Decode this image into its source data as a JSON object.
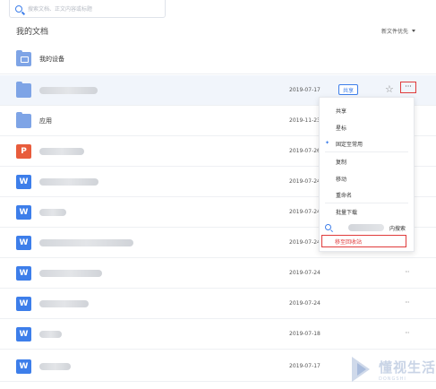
{
  "search": {
    "placeholder": "搜索文档、正文内容或标题"
  },
  "header": {
    "title": "我的文档",
    "sort_label": "新文件优先"
  },
  "rows": [
    {
      "icon": "folder-device-icon",
      "name": "我的设备",
      "date": "",
      "blur": false
    },
    {
      "icon": "folder-icon",
      "name": "",
      "date": "2019-07-17",
      "blur": true
    },
    {
      "icon": "folder-icon",
      "name": "应用",
      "date": "2019-11-23",
      "blur": false
    },
    {
      "icon": "wps-p-icon",
      "name": "",
      "date": "2019-07-26",
      "blur": true
    },
    {
      "icon": "wps-w-icon",
      "name": "",
      "date": "2019-07-24",
      "blur": true
    },
    {
      "icon": "wps-w-icon",
      "name": "",
      "date": "2019-07-24",
      "blur": true
    },
    {
      "icon": "wps-w-icon",
      "name": "",
      "date": "2019-07-24",
      "blur": true
    },
    {
      "icon": "wps-w-icon",
      "name": "",
      "date": "2019-07-24",
      "blur": true
    },
    {
      "icon": "wps-w-icon",
      "name": "",
      "date": "2019-07-24",
      "blur": true
    },
    {
      "icon": "wps-w-icon",
      "name": "",
      "date": "2019-07-18",
      "blur": true
    },
    {
      "icon": "wps-w-icon",
      "name": "",
      "date": "2019-07-17",
      "blur": true
    }
  ],
  "row_actions": {
    "share_badge": "共享",
    "star_icon": "star-icon",
    "more_icon": "more-icon"
  },
  "context_menu": {
    "items": [
      "共享",
      "星标",
      "固定至常用",
      "复制",
      "移动",
      "重命名",
      "批量下载"
    ],
    "search_suffix": "内搜索",
    "delete": "移至回收站"
  },
  "watermark": {
    "cn": "懂视生活",
    "en": "DONGSHI"
  },
  "colors": {
    "accent": "#3d7eea",
    "highlight_red": "#e03b3b",
    "row_hover": "#f1f5fb"
  }
}
